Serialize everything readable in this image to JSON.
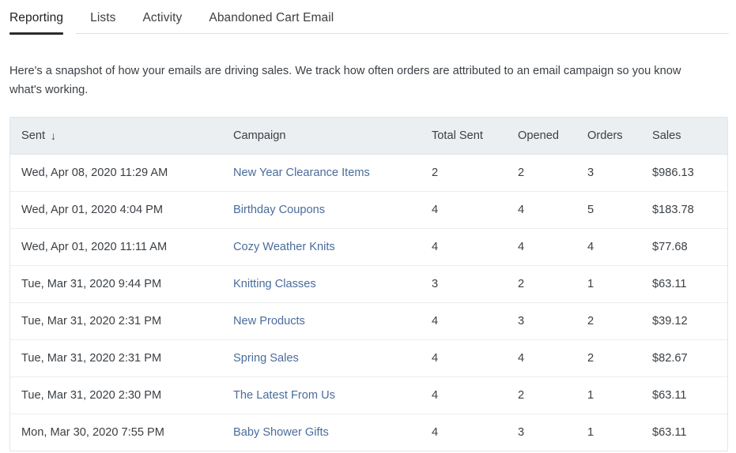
{
  "tabs": [
    {
      "label": "Reporting",
      "active": true
    },
    {
      "label": "Lists",
      "active": false
    },
    {
      "label": "Activity",
      "active": false
    },
    {
      "label": "Abandoned Cart Email",
      "active": false
    }
  ],
  "intro": {
    "text": "Here's a snapshot of how your emails are driving sales. We track how often orders are attributed to an email campaign so you know what's working."
  },
  "table": {
    "columns": [
      {
        "key": "sent",
        "label": "Sent",
        "sort_icon": "↓",
        "sorted": true
      },
      {
        "key": "campaign",
        "label": "Campaign"
      },
      {
        "key": "total_sent",
        "label": "Total Sent"
      },
      {
        "key": "opened",
        "label": "Opened"
      },
      {
        "key": "orders",
        "label": "Orders"
      },
      {
        "key": "sales",
        "label": "Sales"
      }
    ],
    "rows": [
      {
        "sent": "Wed, Apr 08, 2020 11:29 AM",
        "campaign": "New Year Clearance Items",
        "total_sent": "2",
        "opened": "2",
        "orders": "3",
        "sales": "$986.13"
      },
      {
        "sent": "Wed, Apr 01, 2020 4:04 PM",
        "campaign": "Birthday Coupons",
        "total_sent": "4",
        "opened": "4",
        "orders": "5",
        "sales": "$183.78"
      },
      {
        "sent": "Wed, Apr 01, 2020 11:11 AM",
        "campaign": "Cozy Weather Knits",
        "total_sent": "4",
        "opened": "4",
        "orders": "4",
        "sales": "$77.68"
      },
      {
        "sent": "Tue, Mar 31, 2020 9:44 PM",
        "campaign": "Knitting Classes",
        "total_sent": "3",
        "opened": "2",
        "orders": "1",
        "sales": "$63.11"
      },
      {
        "sent": "Tue, Mar 31, 2020 2:31 PM",
        "campaign": "New Products",
        "total_sent": "4",
        "opened": "3",
        "orders": "2",
        "sales": "$39.12"
      },
      {
        "sent": "Tue, Mar 31, 2020 2:31 PM",
        "campaign": "Spring Sales",
        "total_sent": "4",
        "opened": "4",
        "orders": "2",
        "sales": "$82.67"
      },
      {
        "sent": "Tue, Mar 31, 2020 2:30 PM",
        "campaign": "The Latest From Us",
        "total_sent": "4",
        "opened": "2",
        "orders": "1",
        "sales": "$63.11"
      },
      {
        "sent": "Mon, Mar 30, 2020 7:55 PM",
        "campaign": "Baby Shower Gifts",
        "total_sent": "4",
        "opened": "3",
        "orders": "1",
        "sales": "$63.11"
      }
    ]
  },
  "colors": {
    "link": "#4a6c9b",
    "text": "#3b4045",
    "header_bg": "#eceff1",
    "border": "#e2e5e8",
    "active_tab_underline": "#2f2a2e"
  }
}
